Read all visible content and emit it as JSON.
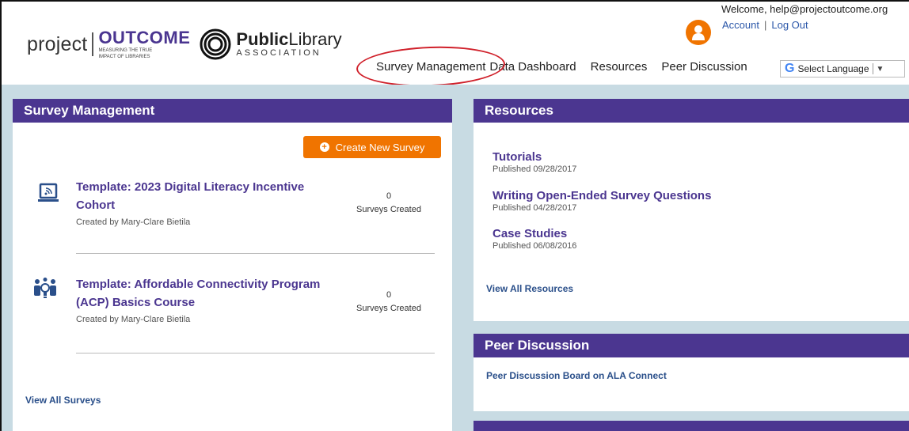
{
  "logo": {
    "project": "project",
    "outcome": "OUTCOME",
    "tagline_1": "MEASURING THE TRUE",
    "tagline_2": "IMPACT OF LIBRARIES",
    "pla_bold": "Public",
    "pla_regular": "Library",
    "pla_assoc": "ASSOCIATION"
  },
  "user": {
    "welcome": "Welcome, help@projectoutcome.org",
    "account": "Account",
    "separator": "|",
    "logout": "Log Out"
  },
  "nav": {
    "items": [
      "Survey Management",
      "Data Dashboard",
      "Resources",
      "Peer Discussion"
    ],
    "language": "Select Language"
  },
  "survey_management": {
    "title": "Survey Management",
    "create_button": "Create New Survey",
    "surveys": [
      {
        "title": "Template: 2023 Digital Literacy Incentive Cohort",
        "created_by": "Created by Mary-Clare Bietila",
        "count": "0",
        "count_label": "Surveys Created",
        "icon": "laptop-wifi-icon"
      },
      {
        "title": "Template: Affordable Connectivity Program (ACP) Basics Course",
        "created_by": "Created by Mary-Clare Bietila",
        "count": "0",
        "count_label": "Surveys Created",
        "icon": "group-idea-icon"
      }
    ],
    "view_all": "View All Surveys"
  },
  "resources": {
    "title": "Resources",
    "items": [
      {
        "title": "Tutorials",
        "date": "Published 09/28/2017"
      },
      {
        "title": "Writing Open-Ended Survey Questions",
        "date": "Published 04/28/2017"
      },
      {
        "title": "Case Studies",
        "date": "Published 06/08/2016"
      }
    ],
    "view_all": "View All Resources"
  },
  "peer_discussion": {
    "title": "Peer Discussion",
    "link": "Peer Discussion Board on ALA Connect"
  },
  "colors": {
    "brand_purple": "#4b3690",
    "accent_orange": "#f07400",
    "background": "#c8dbe3",
    "highlight_red": "#d0202a"
  }
}
